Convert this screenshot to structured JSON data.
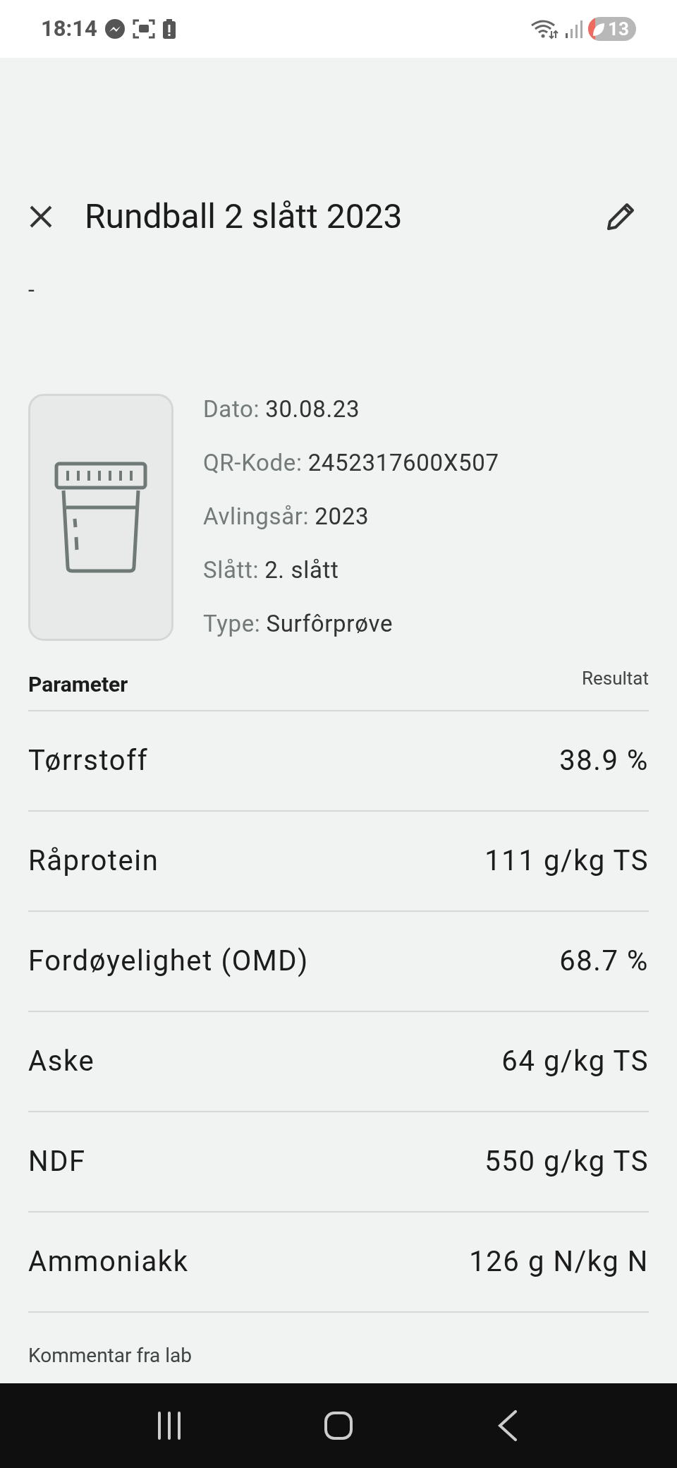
{
  "status_bar": {
    "time": "18:14",
    "battery": "13"
  },
  "header": {
    "title": "Rundball 2 slått 2023",
    "subtitle": "-"
  },
  "sample": {
    "fields": [
      {
        "label": "Dato:",
        "value": "30.08.23"
      },
      {
        "label": "QR-Kode:",
        "value": "2452317600X507"
      },
      {
        "label": "Avlingsår:",
        "value": "2023"
      },
      {
        "label": "Slått:",
        "value": "2. slått"
      },
      {
        "label": "Type:",
        "value": "Surfôrprøve"
      }
    ]
  },
  "table": {
    "columns": [
      "Parameter",
      "Resultat"
    ],
    "rows": [
      {
        "parameter": "Tørrstoff",
        "result": "38.9 %"
      },
      {
        "parameter": "Råprotein",
        "result": "111 g/kg TS"
      },
      {
        "parameter": "Fordøyelighet (OMD)",
        "result": "68.7 %"
      },
      {
        "parameter": "Aske",
        "result": "64 g/kg TS"
      },
      {
        "parameter": "NDF",
        "result": "550 g/kg TS"
      },
      {
        "parameter": "Ammoniakk",
        "result": "126 g N/kg N"
      }
    ]
  },
  "comment_heading": "Kommentar fra lab"
}
